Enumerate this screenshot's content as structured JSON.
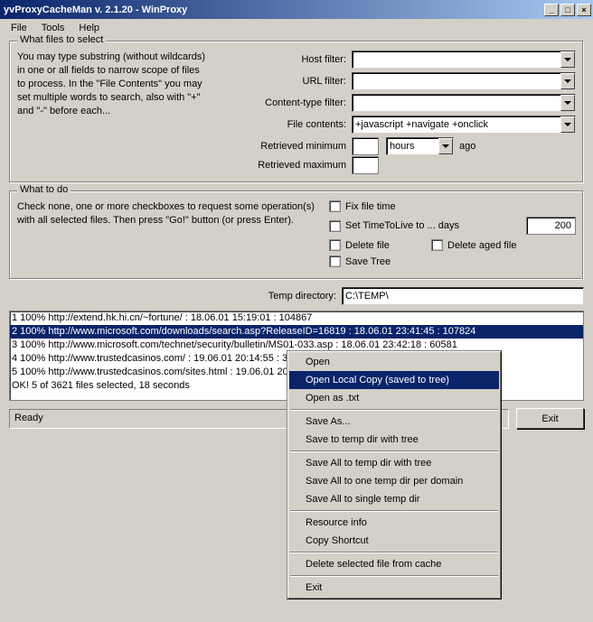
{
  "title": "yvProxyCacheMan v. 2.1.20 - WinProxy",
  "menu": {
    "file": "File",
    "tools": "Tools",
    "help": "Help"
  },
  "select": {
    "legend": "What files to select",
    "help": "You may type substring (without wildcards) in one or all fields to narrow scope of files to process. In the \"File Contents\" you may set multiple words to search, also with \"+\" and \"-\" before each...",
    "host_label": "Host filter:",
    "url_label": "URL filter:",
    "ctype_label": "Content-type filter:",
    "fc_label": "File contents:",
    "fc_value": "+javascript +navigate +onclick",
    "retmin_label": "Retrieved minimum",
    "retmax_label": "Retrieved maximum",
    "unit": "hours",
    "ago": "ago"
  },
  "todo": {
    "legend": "What to do",
    "help": "Check none, one or more checkboxes to request some operation(s) with all selected files. Then press \"Go!\" button (or press Enter).",
    "fix": "Fix file time",
    "ttl": "Set TimeToLive to ... days",
    "ttl_value": "200",
    "del": "Delete file",
    "delaged": "Delete aged file",
    "save": "Save Tree"
  },
  "temp_label": "Temp directory:",
  "temp_value": "C:\\TEMP\\",
  "list": {
    "r1": "1 100% http://extend.hk.hi.cn/~fortune/ : 18.06.01 15:19:01 : 104867",
    "r2": "2 100% http://www.microsoft.com/downloads/search.asp?ReleaseID=16819 : 18.06.01 23:41:45 : 107824",
    "r3": "3 100% http://www.microsoft.com/technet/security/bulletin/MS01-033.asp : 18.06.01 23:42:18 : 60581",
    "r4": "4 100% http://www.trustedcasinos.com/ : 19.06.01 20:14:55 : 34102",
    "r5": "5 100% http://www.trustedcasinos.com/sites.html : 19.06.01 20:15:07 : 28934",
    "r6": "OK! 5 of 3621 files selected, 18 seconds"
  },
  "status": "Ready",
  "exit": "Exit",
  "ctx": {
    "open": "Open",
    "olc": "Open Local Copy (saved to tree)",
    "otxt": "Open as .txt",
    "saveas": "Save As...",
    "savetree": "Save to temp dir with tree",
    "saveall_tree": "Save All to temp dir with tree",
    "saveall_dom": "Save All to one temp dir per domain",
    "saveall_single": "Save All to single temp dir",
    "resinfo": "Resource info",
    "copysc": "Copy Shortcut",
    "delsel": "Delete selected file from cache",
    "exit": "Exit"
  }
}
